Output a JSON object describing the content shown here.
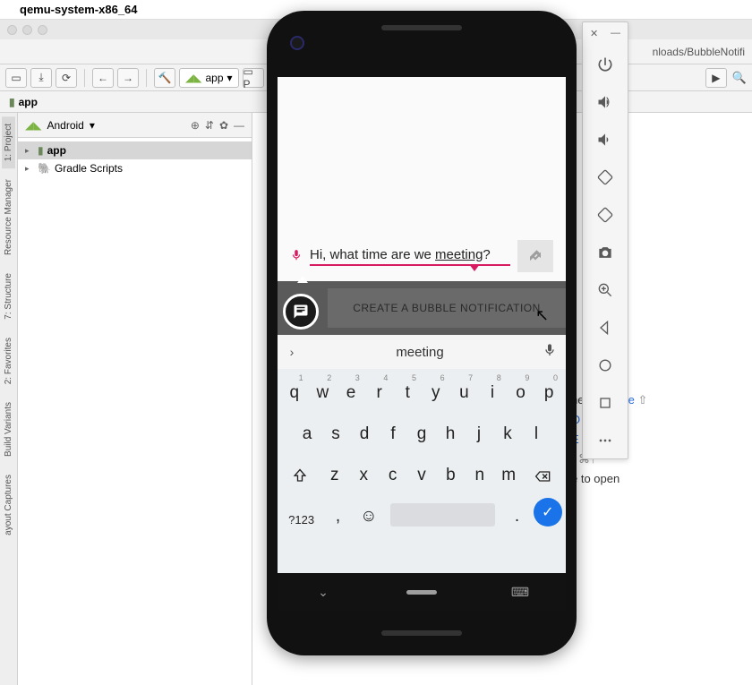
{
  "menubar": {
    "title": "qemu-system-x86_64"
  },
  "pathbar": {
    "tail": "nloads/BubbleNotifi"
  },
  "toolbar": {
    "run_config": "app"
  },
  "breadcrumb": {
    "label": "app"
  },
  "project": {
    "header": "Android",
    "items": [
      {
        "label": "app",
        "bold": true,
        "icon": "folder"
      },
      {
        "label": "Gradle Scripts",
        "bold": false,
        "icon": "gradle"
      }
    ]
  },
  "gutter": {
    "tabs": [
      "1: Project",
      "Resource Manager",
      "7: Structure",
      "2: Favorites",
      "Build Variants",
      "ayout Captures"
    ]
  },
  "editor": {
    "lines": [
      {
        "pre": "here ",
        "kw": "Double",
        "post": " ⇧"
      },
      {
        "pre": "",
        "kw": "O",
        "post": ""
      },
      {
        "pre": "",
        "kw": "E",
        "post": ""
      },
      {
        "pre": "r ",
        "kw": "",
        "post": "⌘↑"
      },
      {
        "pre": "e to open",
        "kw": "",
        "post": ""
      }
    ]
  },
  "phone": {
    "input_text_pre": "Hi, what time are we ",
    "input_text_word": "meeting",
    "input_text_post": "?",
    "banner": "CREATE A BUBBLE NOTIFICATION",
    "suggestion": "meeting",
    "keyboard": {
      "row1": [
        {
          "k": "q",
          "n": "1"
        },
        {
          "k": "w",
          "n": "2"
        },
        {
          "k": "e",
          "n": "3"
        },
        {
          "k": "r",
          "n": "4"
        },
        {
          "k": "t",
          "n": "5"
        },
        {
          "k": "y",
          "n": "6"
        },
        {
          "k": "u",
          "n": "7"
        },
        {
          "k": "i",
          "n": "8"
        },
        {
          "k": "o",
          "n": "9"
        },
        {
          "k": "p",
          "n": "0"
        }
      ],
      "row2": [
        "a",
        "s",
        "d",
        "f",
        "g",
        "h",
        "j",
        "k",
        "l"
      ],
      "row3": [
        "z",
        "x",
        "c",
        "v",
        "b",
        "n",
        "m"
      ],
      "sym_key": "?123",
      "comma": ",",
      "period": "."
    }
  },
  "emu_toolbar": {
    "items": [
      "power",
      "volume-up",
      "volume-down",
      "rotate-left",
      "rotate-right",
      "camera",
      "zoom",
      "back",
      "overview",
      "home",
      "more"
    ]
  }
}
